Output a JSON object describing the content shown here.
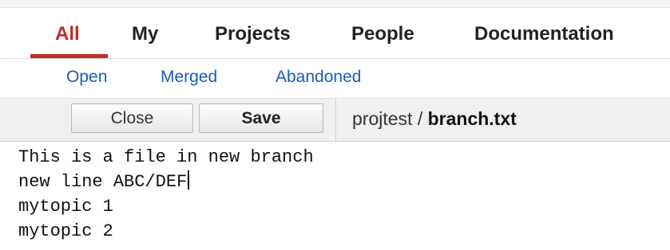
{
  "main_nav": {
    "tabs": [
      {
        "label": "All",
        "active": true
      },
      {
        "label": "My",
        "active": false
      },
      {
        "label": "Projects",
        "active": false
      },
      {
        "label": "People",
        "active": false
      },
      {
        "label": "Documentation",
        "active": false
      }
    ]
  },
  "sub_nav": {
    "links": [
      "Open",
      "Merged",
      "Abandoned"
    ]
  },
  "toolbar": {
    "close_label": "Close",
    "save_label": "Save",
    "breadcrumb": {
      "project": "projtest",
      "separator": " / ",
      "file": "branch.txt"
    }
  },
  "editor": {
    "lines": [
      "This is a file in new branch",
      "new line ABC/DEF",
      "mytopic 1",
      "mytopic 2"
    ],
    "cursor_line": 2
  },
  "colors": {
    "active_tab": "#c22a25",
    "link": "#1a5eb5",
    "toolbar_bg": "#f0f0f0"
  }
}
